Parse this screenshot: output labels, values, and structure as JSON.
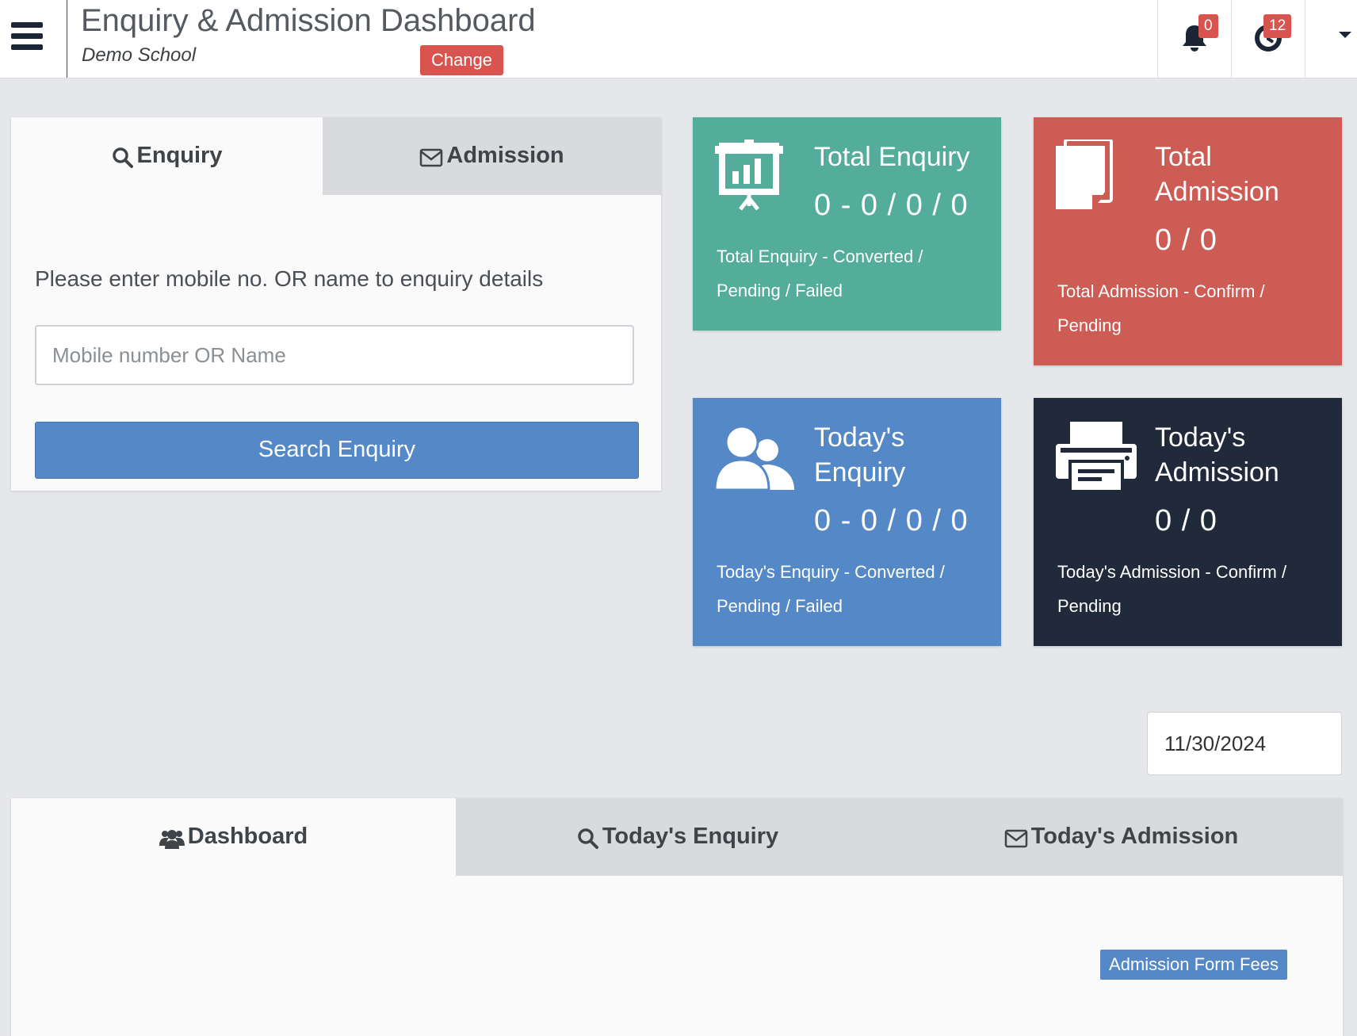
{
  "header": {
    "title": "Enquiry & Admission Dashboard",
    "school_name": "Demo School",
    "change_label": "Change",
    "notifications_count": "0",
    "alerts_count": "12"
  },
  "enquiry_panel": {
    "tabs": [
      {
        "label": "Enquiry",
        "icon": "search-icon",
        "active": true
      },
      {
        "label": "Admission",
        "icon": "envelope-icon",
        "active": false
      }
    ],
    "prompt": "Please enter mobile no. OR name to enquiry details",
    "search_placeholder": "Mobile number OR Name",
    "search_button": "Search Enquiry"
  },
  "stats": {
    "total_enquiry": {
      "title": "Total Enquiry",
      "value": "0 - 0 / 0 / 0",
      "desc_line1": "Total Enquiry - Converted /",
      "desc_line2": "Pending / Failed",
      "color": "#54ac9b",
      "icon": "presentation-chart-icon"
    },
    "total_admission": {
      "title_line1": "Total",
      "title_line2": "Admission",
      "value": "0 / 0",
      "desc_line1": "Total Admission - Confirm /",
      "desc_line2": "Pending",
      "color": "#cd5c55",
      "icon": "documents-icon"
    },
    "todays_enquiry": {
      "title_line1": "Today's",
      "title_line2": "Enquiry",
      "value": "0 - 0 / 0 / 0",
      "desc_line1": "Today's Enquiry - Converted /",
      "desc_line2": "Pending / Failed",
      "color": "#5488c7",
      "icon": "users-icon"
    },
    "todays_admission": {
      "title_line1": "Today's",
      "title_line2": "Admission",
      "value": "0 / 0",
      "desc_line1": "Today's Admission - Confirm /",
      "desc_line2": "Pending",
      "color": "#202a3a",
      "icon": "printer-icon"
    }
  },
  "date_filter": {
    "value": "11/30/2024"
  },
  "bottom_panel": {
    "tabs": [
      {
        "label": "Dashboard",
        "icon": "users-icon",
        "active": true
      },
      {
        "label": "Today's Enquiry",
        "icon": "search-icon",
        "active": false
      },
      {
        "label": "Today's Admission",
        "icon": "envelope-icon",
        "active": false
      }
    ],
    "fees_label": "Admission Form Fees"
  }
}
